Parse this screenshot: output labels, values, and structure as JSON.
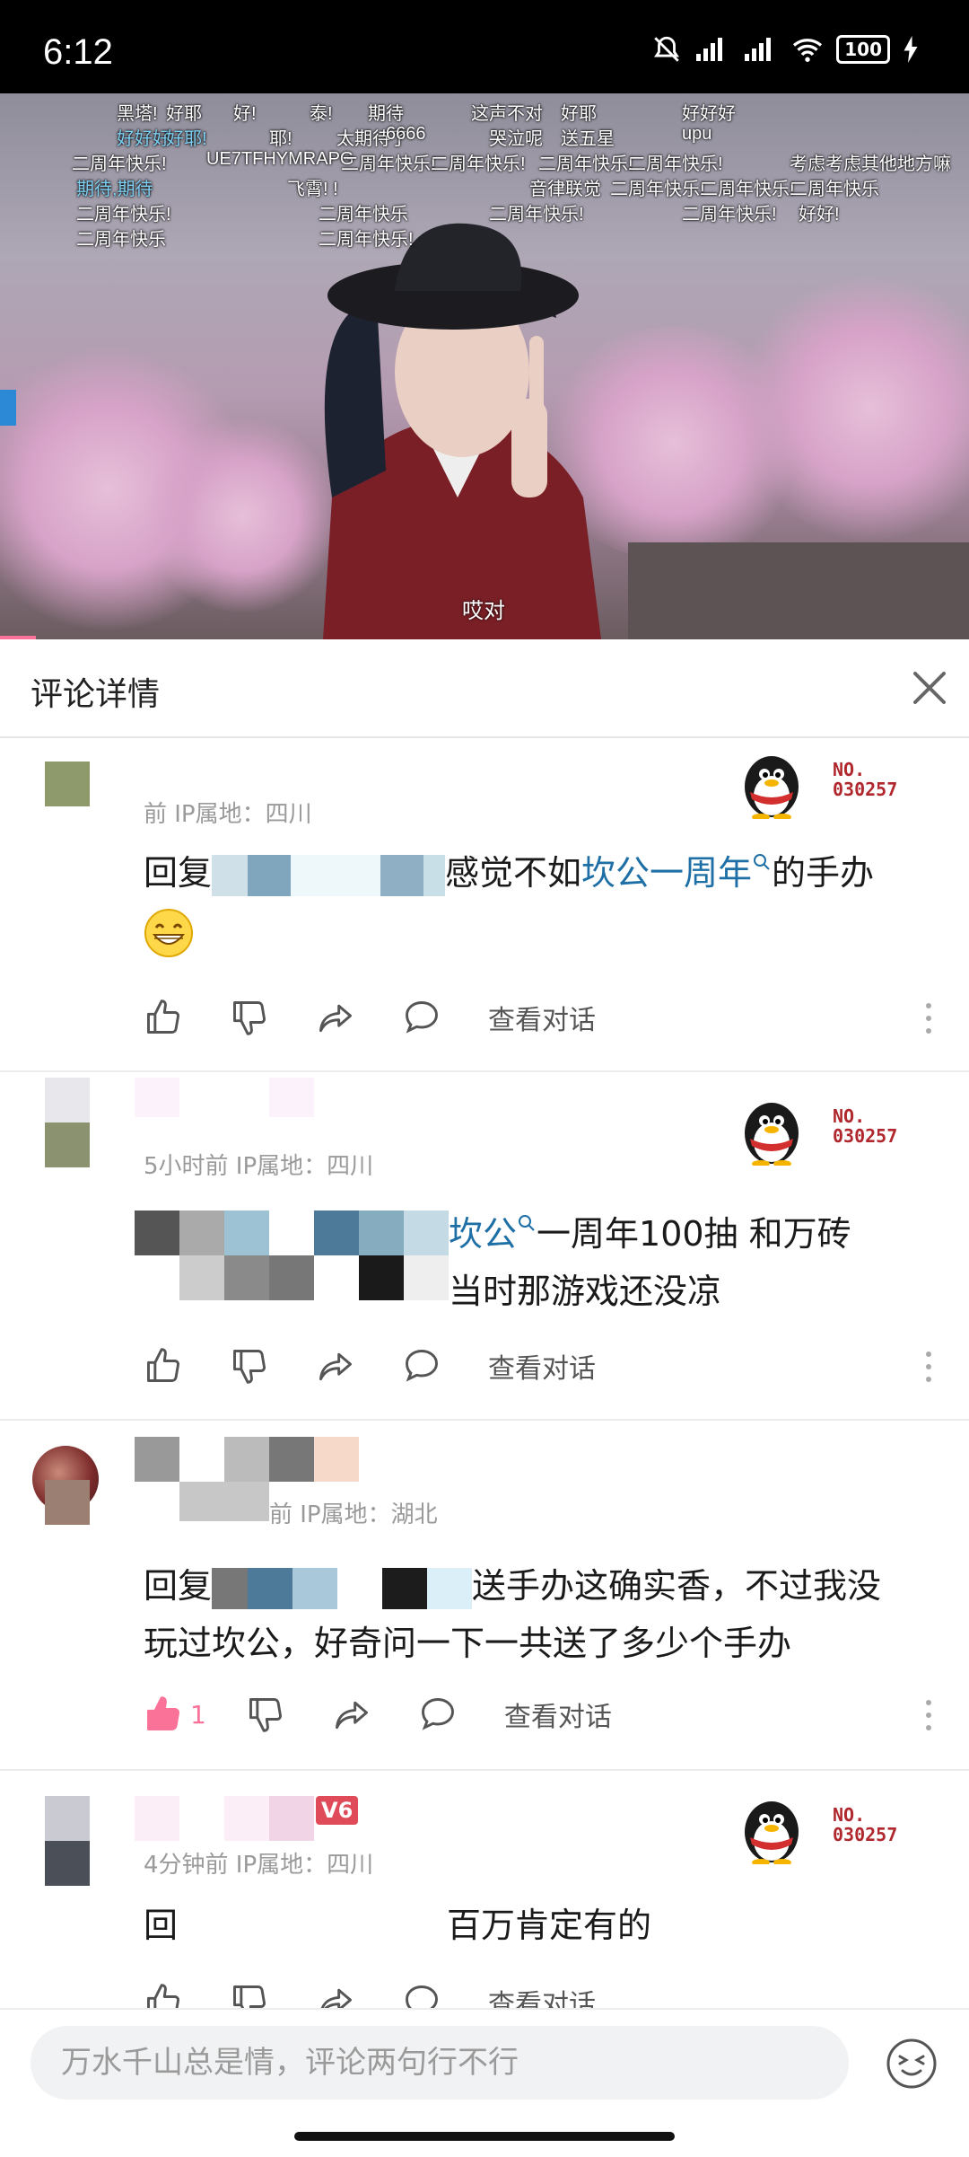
{
  "status": {
    "time": "6:12",
    "battery": "100"
  },
  "video": {
    "subtitle": "哎对",
    "danmaku": [
      {
        "t": "黑塔!",
        "c": 0
      },
      {
        "t": "好耶",
        "c": 0
      },
      {
        "t": "好!",
        "c": 0
      },
      {
        "t": "泰!",
        "c": 0
      },
      {
        "t": "期待",
        "c": 0
      },
      {
        "t": "这声不对",
        "c": 0
      },
      {
        "t": "好耶",
        "c": 0
      },
      {
        "t": "好好好",
        "c": 0
      },
      {
        "t": "好好好",
        "c": 1
      },
      {
        "t": "好耶!",
        "c": 1
      },
      {
        "t": "耶!",
        "c": 0
      },
      {
        "t": "太期待了",
        "c": 0
      },
      {
        "t": "6666",
        "c": 0
      },
      {
        "t": "哭泣呢",
        "c": 0
      },
      {
        "t": "送五星",
        "c": 0
      },
      {
        "t": "upu",
        "c": 0
      },
      {
        "t": "二周年快乐!",
        "c": 0
      },
      {
        "t": "UE7TFHYMRAPG",
        "c": 0
      },
      {
        "t": "二周年快乐!",
        "c": 0
      },
      {
        "t": "二周年快乐!",
        "c": 0
      },
      {
        "t": "二周年快乐!",
        "c": 0
      },
      {
        "t": "二周年快乐!",
        "c": 0
      },
      {
        "t": "考虑考虑其他地方嘛",
        "c": 0
      },
      {
        "t": "期待,期待",
        "c": 1
      },
      {
        "t": "飞霄! !",
        "c": 0
      },
      {
        "t": "音律联觉",
        "c": 0
      },
      {
        "t": "二周年快乐!",
        "c": 0
      },
      {
        "t": "二周年快乐!",
        "c": 0
      },
      {
        "t": "二周年快乐",
        "c": 0
      },
      {
        "t": "二周年快乐!",
        "c": 0
      },
      {
        "t": "二周年快乐",
        "c": 0
      },
      {
        "t": "二周年快乐!",
        "c": 0
      },
      {
        "t": "二周年快乐!",
        "c": 0
      },
      {
        "t": "好好!",
        "c": 0
      },
      {
        "t": "二周年快乐",
        "c": 0
      },
      {
        "t": "二周年快乐!",
        "c": 0
      }
    ]
  },
  "header": {
    "title": "评论详情"
  },
  "comments": [
    {
      "meta": "前 IP属地：四川",
      "text_pre": "回复",
      "text_mid": "感觉不如",
      "link": "坎公一周年",
      "text_post": "的手办",
      "badge": "NO.\n030257",
      "like_count": "",
      "view_conv": "查看对话"
    },
    {
      "meta": "5小时前 IP属地：四川",
      "link": "坎公",
      "text_post": "一周年100抽 和万砖",
      "text_line2": "当时那游戏还没凉",
      "badge": "NO.\n030257",
      "view_conv": "查看对话"
    },
    {
      "meta": "前 IP属地：湖北",
      "text_pre": "回复",
      "text_mid": "送手办这确实香，不过我没",
      "text_line2": "玩过坎公，好奇问一下一共送了多少个手办",
      "like_count": "1",
      "view_conv": "查看对话"
    },
    {
      "meta": "4分钟前 IP属地：四川",
      "text_pre": "回",
      "text_mid": "百万肯定有的",
      "level": "V6",
      "badge": "NO.\n030257",
      "view_conv": "查看对话"
    }
  ],
  "bottom": {
    "placeholder": "万水千山总是情，评论两句行不行"
  },
  "colors": {
    "accent_pink": "#fb7299",
    "link_blue": "#1d6fa5",
    "badge_red": "#b0282d"
  }
}
